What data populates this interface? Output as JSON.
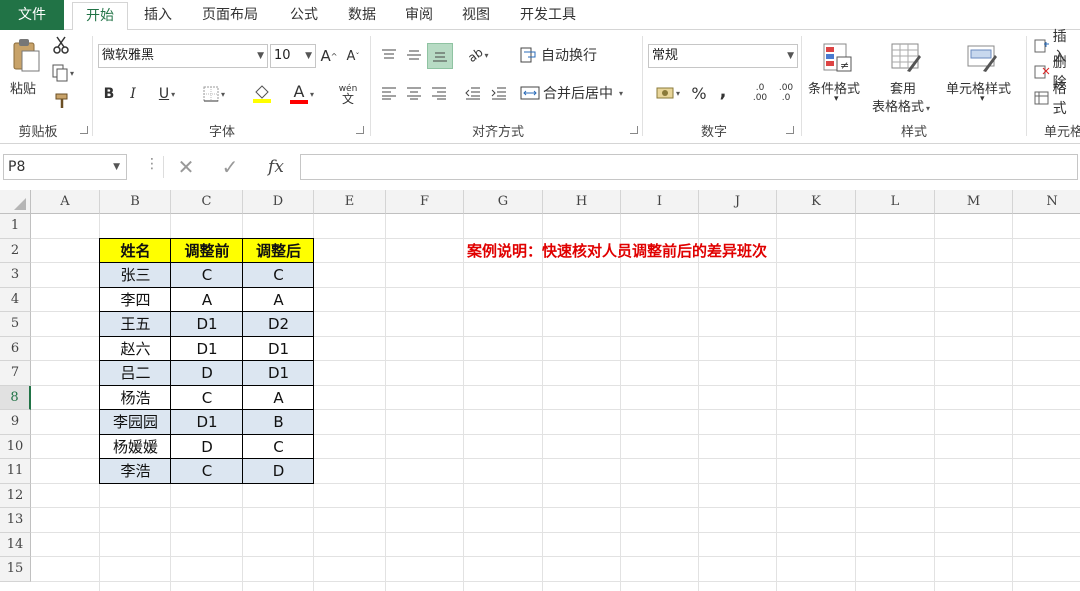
{
  "tabs": [
    {
      "label": "文件"
    },
    {
      "label": "开始"
    },
    {
      "label": "插入"
    },
    {
      "label": "页面布局"
    },
    {
      "label": "公式"
    },
    {
      "label": "数据"
    },
    {
      "label": "审阅"
    },
    {
      "label": "视图"
    },
    {
      "label": "开发工具"
    }
  ],
  "ribbon": {
    "clipboard": {
      "paste": "粘贴",
      "label": "剪贴板"
    },
    "font": {
      "name": "微软雅黑",
      "size": "10",
      "grow": "A",
      "shrink": "A",
      "bold": "B",
      "italic": "I",
      "underline": "U",
      "font_color": "A",
      "phonetic": "wén",
      "phonetic2": "文",
      "label": "字体",
      "highlight_color": "#ffff00",
      "text_color": "#ff0000"
    },
    "alignment": {
      "wrap": "自动换行",
      "merge": "合并后居中",
      "label": "对齐方式"
    },
    "number": {
      "format": "常规",
      "percent": "%",
      "comma": ",",
      "label": "数字",
      "inc_decimal_a": ".0",
      "inc_decimal_b": ".00",
      "dec_decimal_a": ".00",
      "dec_decimal_b": ".0"
    },
    "styles": {
      "conditional": "条件格式",
      "table1": "套用",
      "table2": "表格格式",
      "cell_styles": "单元格样式",
      "label": "样式"
    },
    "cells": {
      "insert": "插入",
      "delete": "删除",
      "format": "格式",
      "label": "单元格"
    }
  },
  "formula_bar": {
    "name_box": "P8",
    "fx": "fx",
    "formula": ""
  },
  "columns": [
    "A",
    "B",
    "C",
    "D",
    "E",
    "F",
    "G",
    "H",
    "I",
    "J",
    "K",
    "L",
    "M",
    "N"
  ],
  "rows": [
    "1",
    "2",
    "3",
    "4",
    "5",
    "6",
    "7",
    "8",
    "9",
    "10",
    "11",
    "12",
    "13",
    "14",
    "15"
  ],
  "selected_row": "8",
  "table": {
    "headers": [
      "姓名",
      "调整前",
      "调整后"
    ],
    "header_bg": "#ffff00",
    "band_bg": "#dce6f1",
    "rows": [
      [
        "张三",
        "C",
        "C"
      ],
      [
        "李四",
        "A",
        "A"
      ],
      [
        "王五",
        "D1",
        "D2"
      ],
      [
        "赵六",
        "D1",
        "D1"
      ],
      [
        "吕二",
        "D",
        "D1"
      ],
      [
        "杨浩",
        "C",
        "A"
      ],
      [
        "李园园",
        "D1",
        "B"
      ],
      [
        "杨媛媛",
        "D",
        "C"
      ],
      [
        "李浩",
        "C",
        "D"
      ]
    ]
  },
  "note": "案例说明：快速核对人员调整前后的差异班次",
  "colors": {
    "accent": "#217346",
    "note": "#e00000"
  }
}
